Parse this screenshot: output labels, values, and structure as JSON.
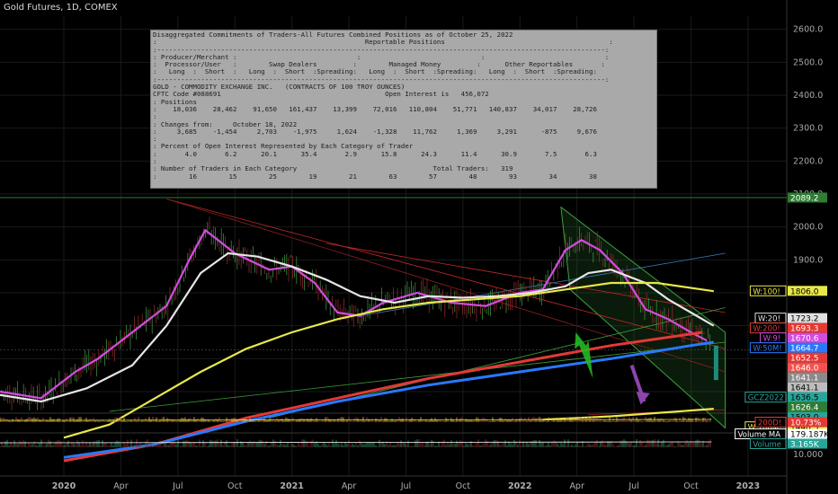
{
  "header": {
    "title": "Gold Futures, 1D, COMEX"
  },
  "cot_report": {
    "lines": [
      "Disaggregated Commitments of Traders-All Futures Combined Positions as of October 25, 2022",
      ":                                                    Reportable Positions                                         :",
      ":----------------------------------------------------------------------------------------------------------------:",
      ": Producer/Merchant :                              :                              :                              :",
      ":  Processor/User   :        Swap Dealers         :        Managed Money         :      Other Reportables       :",
      ":   Long  :  Short  :   Long  :  Short  :Spreading:   Long  :  Short  :Spreading:   Long  :  Short  :Spreading:",
      ":----------------------------------------------------------------------------------------------------------------:",
      "GOLD - COMMODITY EXCHANGE INC.   (CONTRACTS OF 100 TROY OUNCES)",
      "CFTC Code #088691                                         Open Interest is   456,072",
      ": Positions",
      ":    18,036    28,462    91,650   161,437    13,399    72,016   110,804    51,771   140,837    34,017    28,726",
      ":",
      ": Changes from:     October 18, 2022",
      ":     3,685    -1,454     2,703    -1,975     1,624    -1,328    11,762     1,369     3,291      -875     9,676",
      ":",
      ": Percent of Open Interest Represented by Each Category of Trader",
      ":       4.0       6.2      20.1      35.4       2.9      15.8      24.3      11.4      30.9       7.5       6.3",
      ":",
      ": Number of Traders in Each Category                                  Total Traders:   319",
      ":        16        15        25        19        21        63        57        48        93        34        38"
    ]
  },
  "chart_data": {
    "type": "line",
    "title": "Gold Futures, 1D, COMEX",
    "x_ticks": [
      "2020",
      "Apr",
      "Jul",
      "Oct",
      "2021",
      "Apr",
      "Jul",
      "Oct",
      "2022",
      "Apr",
      "Jul",
      "Oct",
      "2023"
    ],
    "x_tick_dates": [
      2020.0,
      2020.25,
      2020.5,
      2020.75,
      2021.0,
      2021.25,
      2021.5,
      2021.75,
      2022.0,
      2022.25,
      2022.5,
      2022.75,
      2023.0
    ],
    "xlim": [
      2019.72,
      2023.17
    ],
    "y_ticks": [
      1500,
      1600,
      1700,
      1800,
      1900,
      2000,
      2100,
      2200,
      2300,
      2400,
      2500,
      2600
    ],
    "y_tick_labels": [
      "1500.0",
      "1600.0",
      "1700.0",
      "1800.0",
      "1900.0",
      "2000.0",
      "2100.0",
      "2200.0",
      "2300.0",
      "2400.0",
      "2500.0",
      "2600.0"
    ],
    "ylim": [
      1440,
      2640
    ],
    "volume_tick": "10.000",
    "price_labels": [
      {
        "label": "",
        "value": "2089.2",
        "price": 2089.2,
        "color": "#2e7d32"
      },
      {
        "label": "W:100!",
        "value": "1806.0",
        "price": 1806.0,
        "color": "#e8e84a"
      },
      {
        "label": "W:20!",
        "value": "1723.2",
        "price": 1723.2,
        "color": "#e0e0e0"
      },
      {
        "label": "W:200!",
        "value": "1693.3",
        "price": 1693.3,
        "color": "#e53935"
      },
      {
        "label": "W:9!",
        "value": "1670.6",
        "price": 1670.6,
        "color": "#d14de0"
      },
      {
        "label": "W:50M!",
        "value": "1664.7",
        "price": 1664.7,
        "color": "#2979ff"
      },
      {
        "label": "",
        "value": "1652.5",
        "price": 1652.5,
        "color": "#e53935"
      },
      {
        "label": "",
        "value": "1646.0",
        "price": 1646.0,
        "color": "#ef5350"
      },
      {
        "label": "",
        "value": "1641.1",
        "price": 1641.1,
        "color": "#8a8a8a"
      },
      {
        "label": "",
        "value": "1641.1",
        "price": 1641.1,
        "color": "#bdbdbd"
      },
      {
        "label": "GCZ2022",
        "value": "1636.5",
        "price": 1636.5,
        "color": "#26a69a"
      },
      {
        "label": "",
        "value": "1626.4",
        "price": 1626.4,
        "color": "#2e7d32"
      },
      {
        "label": "",
        "value": "1503.0",
        "price": 1503.0,
        "color": "#26a69a"
      },
      {
        "label": "W:100M!",
        "value": "1448.3",
        "price": 1448.3,
        "color": "#e8e84a"
      }
    ],
    "indicator_labels": [
      {
        "label": "200D!",
        "value": "10.73%",
        "color": "#e53935"
      },
      {
        "label": "Volume MA",
        "value": "179.187K",
        "color": "#ffffff"
      },
      {
        "label": "Volume",
        "value": "3.165K",
        "color": "#26a69a"
      }
    ],
    "series": [
      {
        "name": "W:9!",
        "color": "#d14de0",
        "x": [
          2019.72,
          2019.9,
          2020.05,
          2020.15,
          2020.3,
          2020.45,
          2020.55,
          2020.62,
          2020.75,
          2020.9,
          2021.0,
          2021.1,
          2021.2,
          2021.3,
          2021.4,
          2021.55,
          2021.7,
          2021.85,
          2022.0,
          2022.1,
          2022.2,
          2022.27,
          2022.35,
          2022.45,
          2022.55,
          2022.65,
          2022.75,
          2022.82
        ],
        "y": [
          1500,
          1480,
          1560,
          1600,
          1680,
          1760,
          1900,
          1990,
          1920,
          1870,
          1880,
          1830,
          1740,
          1730,
          1770,
          1800,
          1770,
          1760,
          1800,
          1810,
          1930,
          1960,
          1930,
          1860,
          1750,
          1720,
          1680,
          1655
        ]
      },
      {
        "name": "W:20!",
        "color": "#e6e6e6",
        "x": [
          2019.72,
          2019.9,
          2020.1,
          2020.3,
          2020.45,
          2020.6,
          2020.72,
          2020.85,
          2021.0,
          2021.15,
          2021.3,
          2021.45,
          2021.6,
          2021.75,
          2021.9,
          2022.05,
          2022.2,
          2022.3,
          2022.4,
          2022.55,
          2022.65,
          2022.75,
          2022.85
        ],
        "y": [
          1490,
          1470,
          1510,
          1580,
          1700,
          1860,
          1920,
          1910,
          1880,
          1840,
          1790,
          1770,
          1790,
          1785,
          1790,
          1800,
          1820,
          1860,
          1870,
          1830,
          1780,
          1740,
          1700
        ]
      },
      {
        "name": "W:100!",
        "color": "#e8e84a",
        "x": [
          2020.0,
          2020.2,
          2020.4,
          2020.6,
          2020.8,
          2021.0,
          2021.2,
          2021.4,
          2021.6,
          2021.8,
          2022.0,
          2022.2,
          2022.4,
          2022.6,
          2022.85
        ],
        "y": [
          1360,
          1400,
          1480,
          1560,
          1630,
          1680,
          1720,
          1750,
          1770,
          1780,
          1790,
          1810,
          1830,
          1830,
          1805
        ]
      },
      {
        "name": "W:200!",
        "color": "#e53935",
        "x": [
          2020.0,
          2020.4,
          2020.8,
          2021.2,
          2021.6,
          2022.0,
          2022.4,
          2022.8
        ],
        "y": [
          1290,
          1340,
          1420,
          1480,
          1540,
          1590,
          1640,
          1680
        ]
      },
      {
        "name": "W:50M!",
        "color": "#2979ff",
        "x": [
          2020.0,
          2020.4,
          2020.8,
          2021.2,
          2021.6,
          2022.0,
          2022.4,
          2022.75,
          2022.85
        ],
        "y": [
          1300,
          1340,
          1410,
          1470,
          1520,
          1560,
          1600,
          1640,
          1650
        ]
      },
      {
        "name": "W:100M!",
        "color": "#e8e84a",
        "x": [
          2022.1,
          2022.4,
          2022.7,
          2022.85
        ],
        "y": [
          1415,
          1425,
          1440,
          1448
        ]
      }
    ]
  }
}
